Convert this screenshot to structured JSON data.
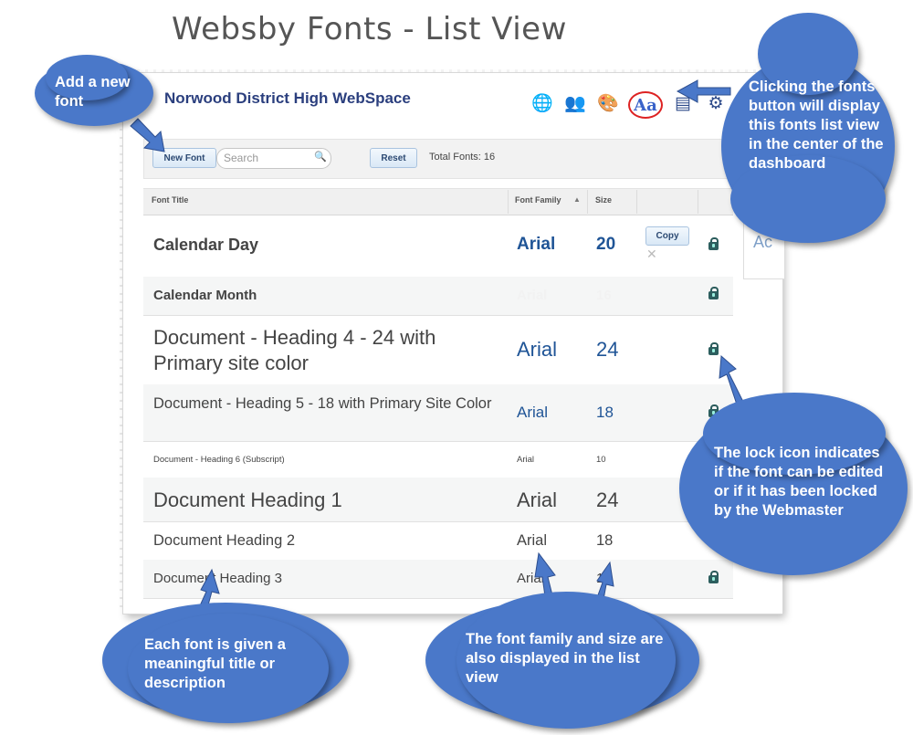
{
  "page_title": "Websby Fonts - List View",
  "site_name": "Norwood District High WebSpace",
  "toolbar": {
    "new_font_label": "New Font",
    "search_placeholder": "Search",
    "reset_label": "Reset",
    "total_fonts": "Total Fonts: 16"
  },
  "table": {
    "headers": {
      "title": "Font Title",
      "family": "Font Family",
      "size": "Size"
    },
    "copy_label": "Copy",
    "rows": [
      {
        "title": "Calendar Day",
        "family": "Arial",
        "size": "20",
        "locked": true
      },
      {
        "title": "Calendar Month",
        "family": "Arial",
        "size": "16",
        "locked": true
      },
      {
        "title": "Document - Heading 4 - 24 with Primary site color",
        "family": "Arial",
        "size": "24",
        "locked": true
      },
      {
        "title": "Document - Heading 5 - 18 with Primary Site Color",
        "family": "Arial",
        "size": "18",
        "locked": true
      },
      {
        "title": "Document - Heading 6 (Subscript)",
        "family": "Arial",
        "size": "10",
        "locked": false
      },
      {
        "title": "Document Heading 1",
        "family": "Arial",
        "size": "24",
        "locked": false
      },
      {
        "title": "Document Heading 2",
        "family": "Arial",
        "size": "18",
        "locked": false
      },
      {
        "title": "Document Heading 3",
        "family": "Arial",
        "size": "16",
        "locked": true
      }
    ]
  },
  "side_text": "Ac",
  "callouts": {
    "add_font": "Add a new font",
    "fonts_button": "Clicking the fonts button will display this fonts list view in the center of the dashboard",
    "lock_icon": "The lock icon indicates if the font can be edited or if it has been locked by the Webmaster",
    "title_desc": "Each font is given a meaningful title or description",
    "family_size": "The font family and size are also displayed in the list view"
  },
  "icons": [
    "globe-icon",
    "add-user-icon",
    "palette-icon",
    "fonts-icon",
    "page-icon",
    "settings-icon",
    "search-icon",
    "lock-icon",
    "delete-icon",
    "sort-asc-icon"
  ],
  "colors": {
    "callout": "#4a78c9",
    "header_text": "#2b3f7e",
    "family_text": "#1f5496",
    "highlight_ring": "#dd2222"
  }
}
